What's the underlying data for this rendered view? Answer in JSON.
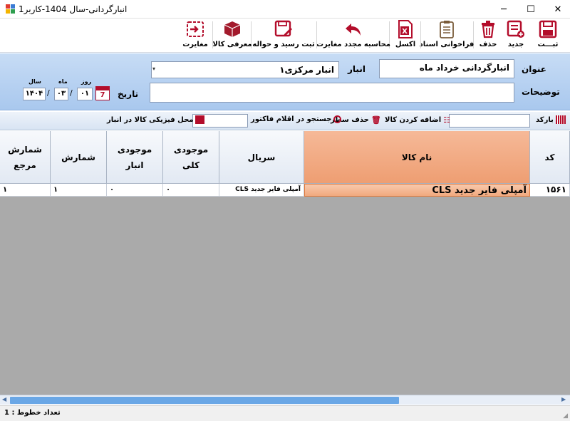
{
  "window": {
    "title": "انبارگردانی-سال 1404-کاربر1"
  },
  "toolbar": {
    "save": "ثبـــت",
    "new": "جدید",
    "delete": "حذف",
    "docs": "فراخوانی اسناد",
    "excel": "اکسل",
    "recalc": "محاسبه مجدد مغایرت",
    "receipt": "ثبت رسید و حواله",
    "goods": "معرفی کالا",
    "diff": "مغایرت"
  },
  "form": {
    "title_label": "عنوان",
    "title_value": "انبارگردانی خرداد ماه",
    "warehouse_label": "انبار",
    "warehouse_value": "انبار مرکزی۱",
    "desc_label": "توضیحات",
    "desc_value": "",
    "date_label": "تاریخ",
    "day_label": "روز",
    "month_label": "ماه",
    "year_label": "سال",
    "day": "۰۱",
    "month": "۰۳",
    "year": "۱۴۰۴",
    "calendar_num": "7"
  },
  "actions": {
    "barcode_label": "بارکد",
    "add_goods": "اضافه کردن کالا",
    "delete_row": "حذف سطر",
    "search_invoice": "جستجو در اقلام فاکتور",
    "location": "محل فیزیکی کالا در انبار"
  },
  "grid": {
    "headers": {
      "code": "کد",
      "name": "نام کالا",
      "serial": "سریال",
      "stock_total_1": "موجودی",
      "stock_total_2": "کلی",
      "stock_wh_1": "موجودی",
      "stock_wh_2": "انبار",
      "count": "شمارش",
      "ref_1": "شمارش",
      "ref_2": "مرجع"
    },
    "rows": [
      {
        "code": "۱۵۶۱",
        "name": "آمپلی فایر جدید CLS",
        "serial": "آمپلی فایر جدید CLS",
        "stock_total": "۰",
        "stock_wh": "۰",
        "count": "۱",
        "ref": "۱"
      }
    ]
  },
  "status": {
    "row_count": "تعداد خطوط : 1"
  },
  "colors": {
    "accent": "#f2a97e",
    "panel": "#b8d2f1",
    "scrollbar": "#6aa7e6"
  }
}
